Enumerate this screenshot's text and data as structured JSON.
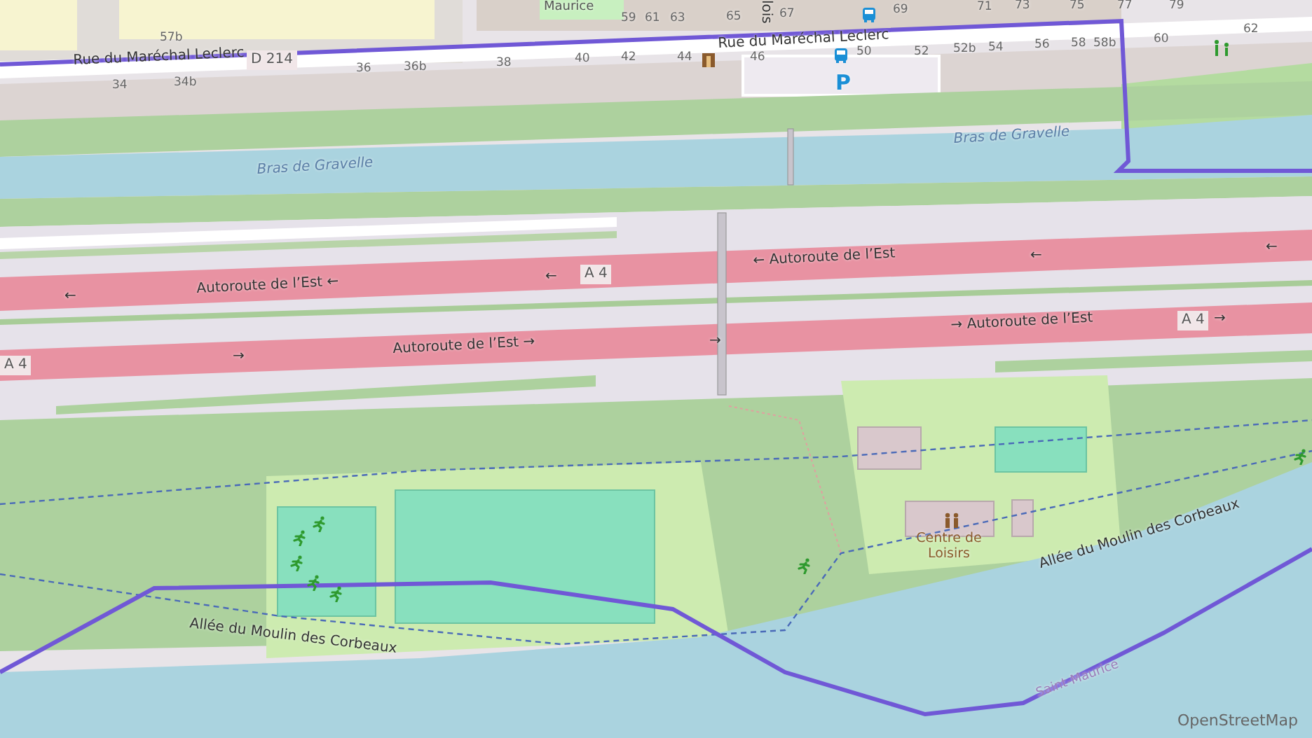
{
  "map": {
    "labels": [
      {
        "kind": "place",
        "text": "Maurice"
      },
      {
        "kind": "house",
        "text": "57b"
      },
      {
        "kind": "street",
        "text": "Rue du Maréchal Leclerc"
      },
      {
        "kind": "ref",
        "text": "D 214"
      },
      {
        "kind": "house",
        "text": "34"
      },
      {
        "kind": "house",
        "text": "34b"
      },
      {
        "kind": "house",
        "text": "36"
      },
      {
        "kind": "house",
        "text": "36b"
      },
      {
        "kind": "house",
        "text": "38"
      },
      {
        "kind": "house",
        "text": "40"
      },
      {
        "kind": "house",
        "text": "42"
      },
      {
        "kind": "house",
        "text": "44"
      },
      {
        "kind": "house",
        "text": "46"
      },
      {
        "kind": "house",
        "text": "50"
      },
      {
        "kind": "house",
        "text": "52"
      },
      {
        "kind": "house",
        "text": "52b"
      },
      {
        "kind": "house",
        "text": "54"
      },
      {
        "kind": "house",
        "text": "56"
      },
      {
        "kind": "house",
        "text": "58"
      },
      {
        "kind": "house",
        "text": "58b"
      },
      {
        "kind": "house",
        "text": "60"
      },
      {
        "kind": "house",
        "text": "62"
      },
      {
        "kind": "house",
        "text": "59"
      },
      {
        "kind": "house",
        "text": "61"
      },
      {
        "kind": "house",
        "text": "63"
      },
      {
        "kind": "house",
        "text": "65"
      },
      {
        "kind": "house",
        "text": "67"
      },
      {
        "kind": "house",
        "text": "69"
      },
      {
        "kind": "house",
        "text": "71"
      },
      {
        "kind": "house",
        "text": "73"
      },
      {
        "kind": "house",
        "text": "75"
      },
      {
        "kind": "house",
        "text": "77"
      },
      {
        "kind": "house",
        "text": "79"
      },
      {
        "kind": "street",
        "text": "lois"
      },
      {
        "kind": "street",
        "text": "Rue du Maréchal Leclerc"
      },
      {
        "kind": "parking",
        "text": "P"
      },
      {
        "kind": "water",
        "text": "Bras de Gravelle"
      },
      {
        "kind": "water",
        "text": "Bras de Gravelle"
      },
      {
        "kind": "street",
        "text": "Autoroute de l’Est ←"
      },
      {
        "kind": "street",
        "text": "← Autoroute de l’Est"
      },
      {
        "kind": "street",
        "text": "Autoroute de l’Est →"
      },
      {
        "kind": "street",
        "text": "→ Autoroute de l’Est"
      },
      {
        "kind": "ref",
        "text": "A 4"
      },
      {
        "kind": "ref",
        "text": "A 4"
      },
      {
        "kind": "ref",
        "text": "A 4"
      },
      {
        "kind": "oneway",
        "text": "←"
      },
      {
        "kind": "oneway",
        "text": "←"
      },
      {
        "kind": "oneway",
        "text": "←"
      },
      {
        "kind": "oneway",
        "text": "←"
      },
      {
        "kind": "oneway",
        "text": "→"
      },
      {
        "kind": "oneway",
        "text": "→"
      },
      {
        "kind": "oneway",
        "text": "→"
      },
      {
        "kind": "poi",
        "text": "Centre de Loisirs"
      },
      {
        "kind": "street",
        "text": "Allée du Moulin des Corbeaux"
      },
      {
        "kind": "street",
        "text": "Allée du Moulin des Corbeaux"
      },
      {
        "kind": "boundary",
        "text": "Saint-Maurice"
      }
    ]
  },
  "attribution": "OpenStreetMap"
}
